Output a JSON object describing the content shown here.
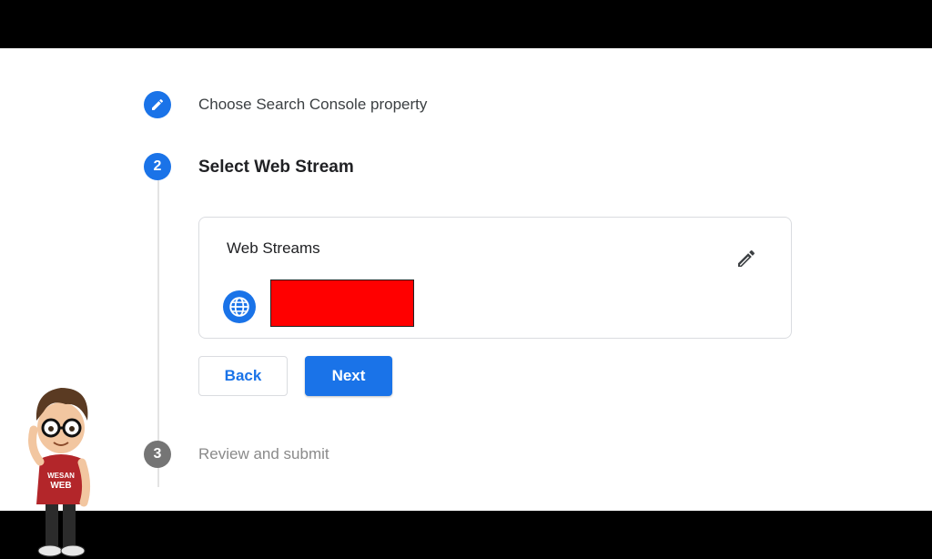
{
  "steps": [
    {
      "number": "",
      "label": "Choose Search Console property",
      "state": "completed",
      "icon": "pencil-icon"
    },
    {
      "number": "2",
      "label": "Select Web Stream",
      "state": "active"
    },
    {
      "number": "3",
      "label": "Review and submit",
      "state": "upcoming"
    }
  ],
  "card": {
    "title": "Web Streams",
    "edit_icon": "pencil-icon",
    "stream_icon": "globe-icon"
  },
  "buttons": {
    "back_label": "Back",
    "next_label": "Next"
  },
  "mascot": {
    "shirt_text_line1": "WESAN",
    "shirt_text_line2": "WEB"
  },
  "colors": {
    "accent": "#1a73e8",
    "redaction": "#ff0000",
    "muted_step": "#757575"
  }
}
